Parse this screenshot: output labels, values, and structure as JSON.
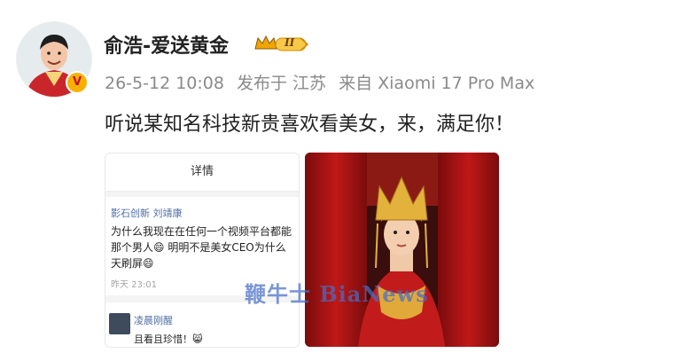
{
  "user": {
    "name": "俞浩-爱送黄金",
    "verified_badge": "V",
    "level_badge": "II"
  },
  "meta": {
    "time": "26-5-12 10:08",
    "location": "发布于 江苏",
    "device": "来自 Xiaomi 17 Pro Max"
  },
  "post": {
    "text": "听说某知名科技新贵喜欢看美女，来，满足你！"
  },
  "screenshot": {
    "header": "详情",
    "author": "影石创新 刘靖康",
    "lines": [
      "为什么我现在在任何一个视频平台都能",
      "那个男人😄 明明不是美女CEO为什么",
      "天刷屏😄"
    ],
    "time": "昨天 23:01",
    "reply_name": "凌晨刚醒",
    "reply_text": "且看且珍惜！😸"
  },
  "watermark": "鞭牛士 BiaNews",
  "colors": {
    "name": "#222222",
    "meta": "#8a8a8a",
    "link": "#4e6fa6"
  }
}
